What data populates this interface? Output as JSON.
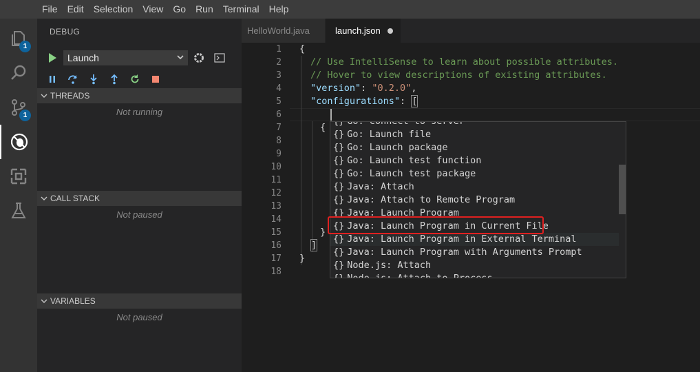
{
  "menu": [
    "File",
    "Edit",
    "Selection",
    "View",
    "Go",
    "Run",
    "Terminal",
    "Help"
  ],
  "activity": {
    "explorer_badge": "1",
    "scm_badge": "1"
  },
  "sidebar": {
    "title": "DEBUG",
    "config_selected": "Launch",
    "sections": [
      {
        "title": "THREADS",
        "empty": "Not running"
      },
      {
        "title": "CALL STACK",
        "empty": "Not paused"
      },
      {
        "title": "VARIABLES",
        "empty": "Not paused"
      }
    ]
  },
  "tabs": [
    {
      "label": "HelloWorld.java"
    },
    {
      "label": "launch.json"
    }
  ],
  "editor": {
    "line_numbers": [
      "1",
      "2",
      "3",
      "4",
      "5",
      "6",
      "7",
      "8",
      "9",
      "10",
      "11",
      "12",
      "13",
      "14",
      "15",
      "16",
      "17",
      "18"
    ],
    "lines": {
      "l1": "{",
      "l2": "// Use IntelliSense to learn about possible attributes.",
      "l3": "// Hover to view descriptions of existing attributes.",
      "l4_key": "\"version\"",
      "l4_sep": ": ",
      "l4_val": "\"0.2.0\"",
      "l4_end": ",",
      "l5_key": "\"configurations\"",
      "l5_sep": ": ",
      "l5_open": "[",
      "l7": "{",
      "l15": "}",
      "l16": "]",
      "l17": "}"
    }
  },
  "suggestions": {
    "icon": "{}",
    "items": [
      "Go: Connect to server",
      "Go: Launch file",
      "Go: Launch package",
      "Go: Launch test function",
      "Go: Launch test package",
      "Java: Attach",
      "Java: Attach to Remote Program",
      "Java: Launch Program",
      "Java: Launch Program in Current File",
      "Java: Launch Program in External Terminal",
      "Java: Launch Program with Arguments Prompt",
      "Node.js: Attach",
      "Node.js: Attach to Process"
    ],
    "highlighted_index": 8
  },
  "colors": {
    "accent": "#0e639c",
    "highlight_border": "#e02020",
    "start_green": "#89d185",
    "debug_blue": "#75beff",
    "stop_red": "#f48771"
  }
}
